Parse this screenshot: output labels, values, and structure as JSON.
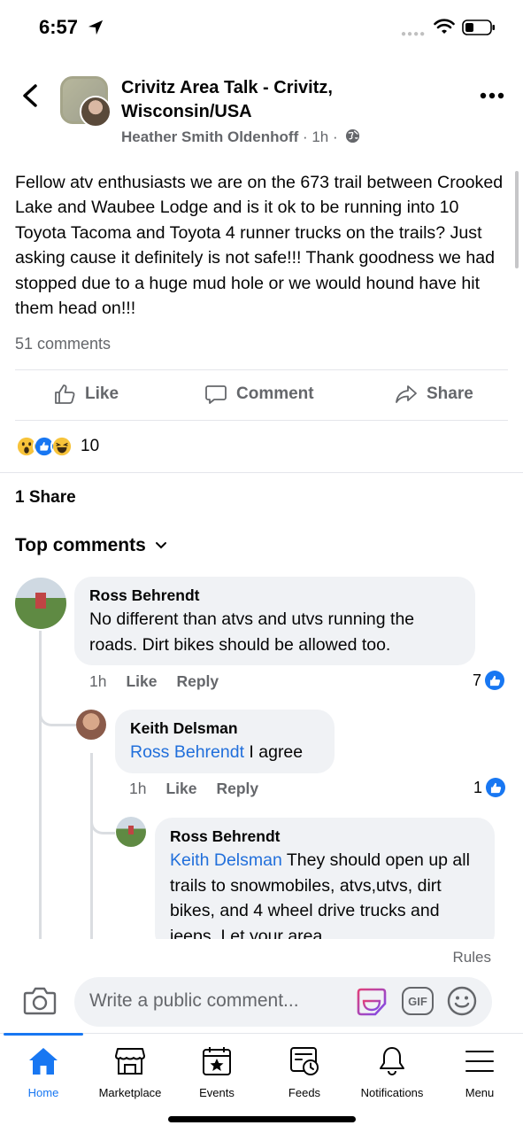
{
  "status_bar": {
    "time": "6:57"
  },
  "post": {
    "group_title": "Crivitz Area Talk - Crivitz, Wisconsin/USA",
    "author": "Heather Smith Oldenhoff",
    "time": "1h",
    "body": "Fellow atv enthusiasts we are on the 673 trail between Crooked Lake and Waubee Lodge and is it ok to be running into 10 Toyota Tacoma and Toyota 4 runner trucks on the trails?  Just asking cause it definitely is not safe!!!  Thank goodness we had stopped due to a huge mud hole or we would hound have hit them head on!!!",
    "comment_count": "51 comments",
    "reaction_count": "10",
    "share_count": "1 Share"
  },
  "actions": {
    "like": "Like",
    "comment": "Comment",
    "share": "Share"
  },
  "comments_header": "Top comments",
  "comments": [
    {
      "author": "Ross Behrendt",
      "mention": "",
      "text": "No different than atvs and utvs running the roads. Dirt bikes should be allowed too.",
      "time": "1h",
      "like_label": "Like",
      "reply_label": "Reply",
      "likes": "7"
    },
    {
      "author": "Keith Delsman",
      "mention": "Ross Behrendt",
      "text": " I agree",
      "time": "1h",
      "like_label": "Like",
      "reply_label": "Reply",
      "likes": "1"
    },
    {
      "author": "Ross Behrendt",
      "mention": "Keith Delsman",
      "text": " They should open up all trails to snowmobiles, atvs,utvs, dirt bikes, and 4 wheel drive trucks and jeeps. Let your area"
    }
  ],
  "composer": {
    "rules": "Rules",
    "placeholder": "Write a public comment...",
    "gif": "GIF"
  },
  "tabs": [
    {
      "label": "Home",
      "icon": "home-icon",
      "active": true
    },
    {
      "label": "Marketplace",
      "icon": "marketplace-icon"
    },
    {
      "label": "Events",
      "icon": "events-icon"
    },
    {
      "label": "Feeds",
      "icon": "feeds-icon"
    },
    {
      "label": "Notifications",
      "icon": "bell-icon"
    },
    {
      "label": "Menu",
      "icon": "menu-icon"
    }
  ],
  "colors": {
    "accent": "#1877f2",
    "mention": "#216fdb",
    "secondary_text": "#65676b",
    "bubble": "#f0f2f5"
  }
}
